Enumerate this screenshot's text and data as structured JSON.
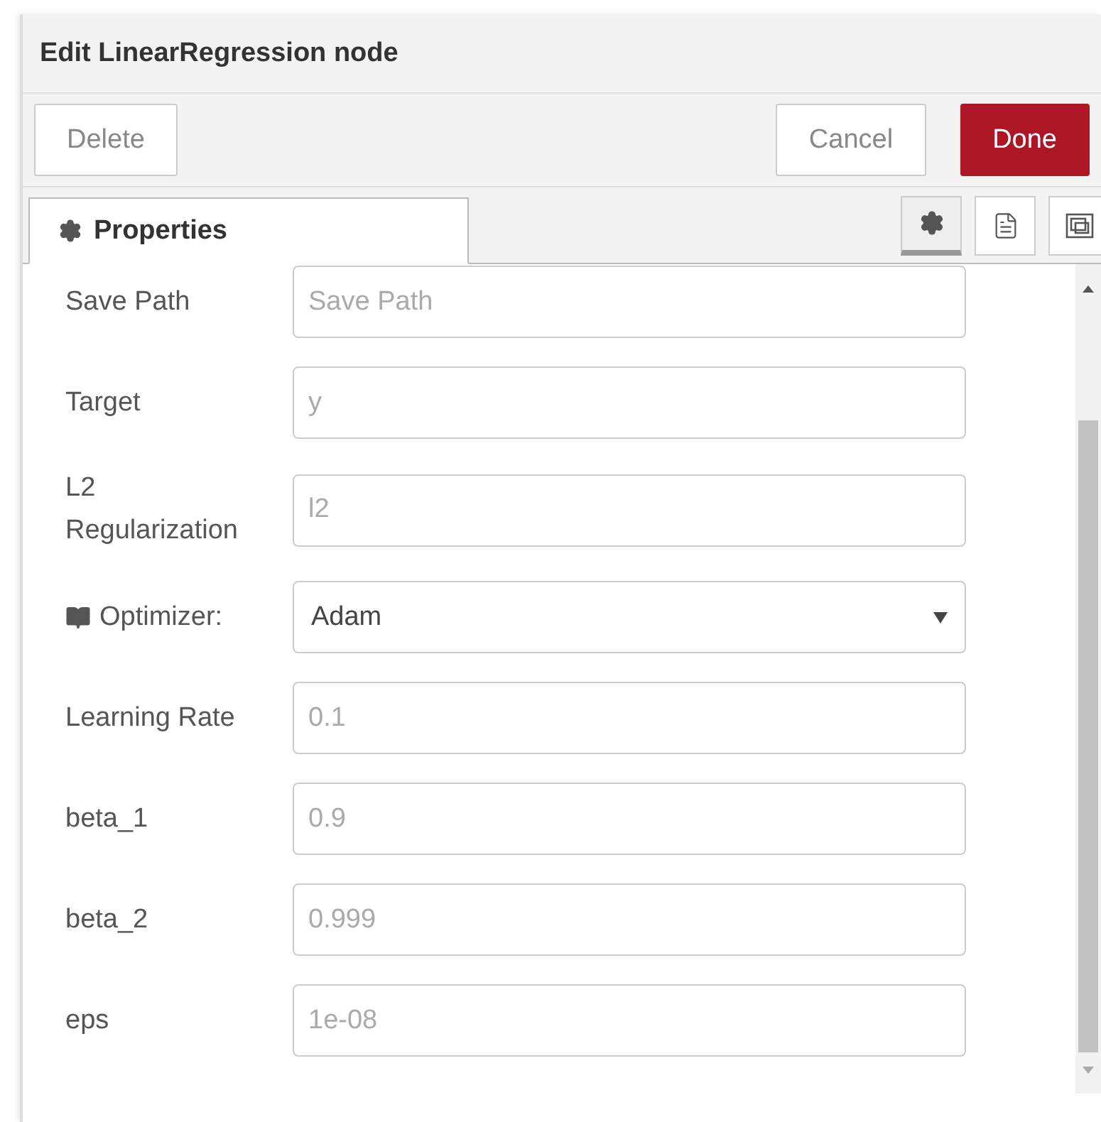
{
  "title": "Edit LinearRegression node",
  "actions": [
    {
      "label": "Delete",
      "kind": "plain"
    },
    {
      "label": "Cancel",
      "kind": "plain"
    },
    {
      "label": "Done",
      "kind": "primary"
    }
  ],
  "tab": {
    "label": "Properties",
    "selected": true
  },
  "tool_buttons": [
    {
      "kind": "settings",
      "selected": true
    },
    {
      "kind": "description",
      "selected": false
    },
    {
      "kind": "appearance",
      "selected": false
    }
  ],
  "fields": [
    {
      "label": "Save Path",
      "kind": "text",
      "placeholder": "Save Path"
    },
    {
      "label": "Target",
      "kind": "text",
      "placeholder": "y"
    },
    {
      "label": "L2 Regularization",
      "kind": "text",
      "placeholder": "l2"
    },
    {
      "label": "Optimizer:",
      "kind": "select",
      "value": "Adam"
    },
    {
      "label": "Learning Rate",
      "kind": "text",
      "placeholder": "0.1"
    },
    {
      "label": "beta_1",
      "kind": "text",
      "placeholder": "0.9"
    },
    {
      "label": "beta_2",
      "kind": "text",
      "placeholder": "0.999"
    },
    {
      "label": "eps",
      "kind": "text",
      "placeholder": "1e-08"
    }
  ]
}
